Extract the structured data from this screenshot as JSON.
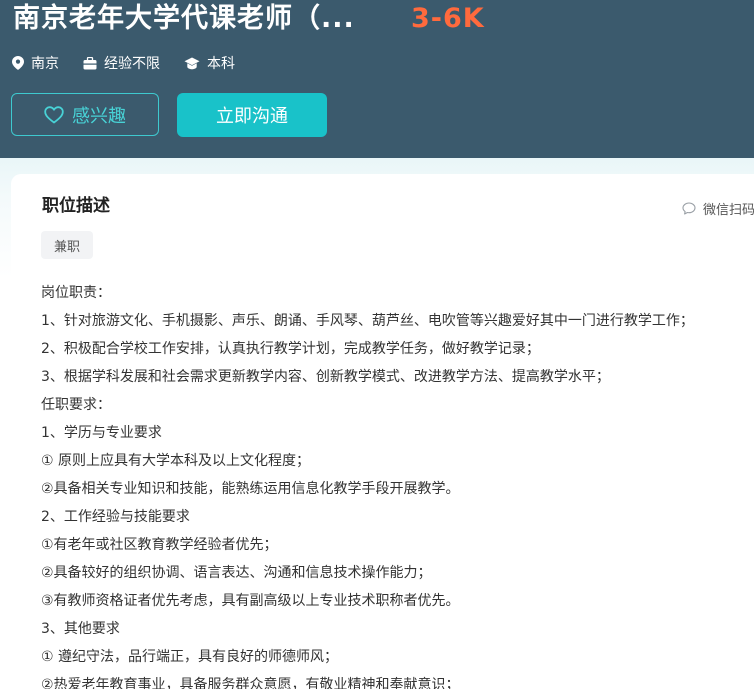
{
  "header": {
    "title": "南京老年大学代课老师（...",
    "salary": "3-6K",
    "meta": {
      "city": "南京",
      "experience": "经验不限",
      "education": "本科"
    },
    "interest_button": "感兴趣",
    "chat_button": "立即沟通"
  },
  "detail": {
    "section_title": "职位描述",
    "wechat_label": "微信扫码",
    "tag": "兼职",
    "lines": [
      "岗位职责：",
      "1、针对旅游文化、手机摄影、声乐、朗诵、手风琴、葫芦丝、电吹管等兴趣爱好其中一门进行教学工作；",
      "2、积极配合学校工作安排，认真执行教学计划，完成教学任务，做好教学记录；",
      "3、根据学科发展和社会需求更新教学内容、创新教学模式、改进教学方法、提高教学水平；",
      "任职要求：",
      "1、学历与专业要求",
      "① 原则上应具有大学本科及以上文化程度；",
      "②具备相关专业知识和技能，能熟练运用信息化教学手段开展教学。",
      "2、工作经验与技能要求",
      "①有老年或社区教育教学经验者优先；",
      "②具备较好的组织协调、语言表达、沟通和信息技术操作能力；",
      "③有教师资格证者优先考虑，具有副高级以上专业技术职称者优先。",
      "3、其他要求",
      "① 遵纪守法，品行端正，具有良好的师德师风；",
      "②热爱老年教育事业，具备服务群众意愿，有敬业精神和奉献意识；"
    ]
  },
  "colors": {
    "header_bg": "#3b5a6d",
    "salary": "#ff6a3d",
    "accent": "#19c2c9"
  }
}
